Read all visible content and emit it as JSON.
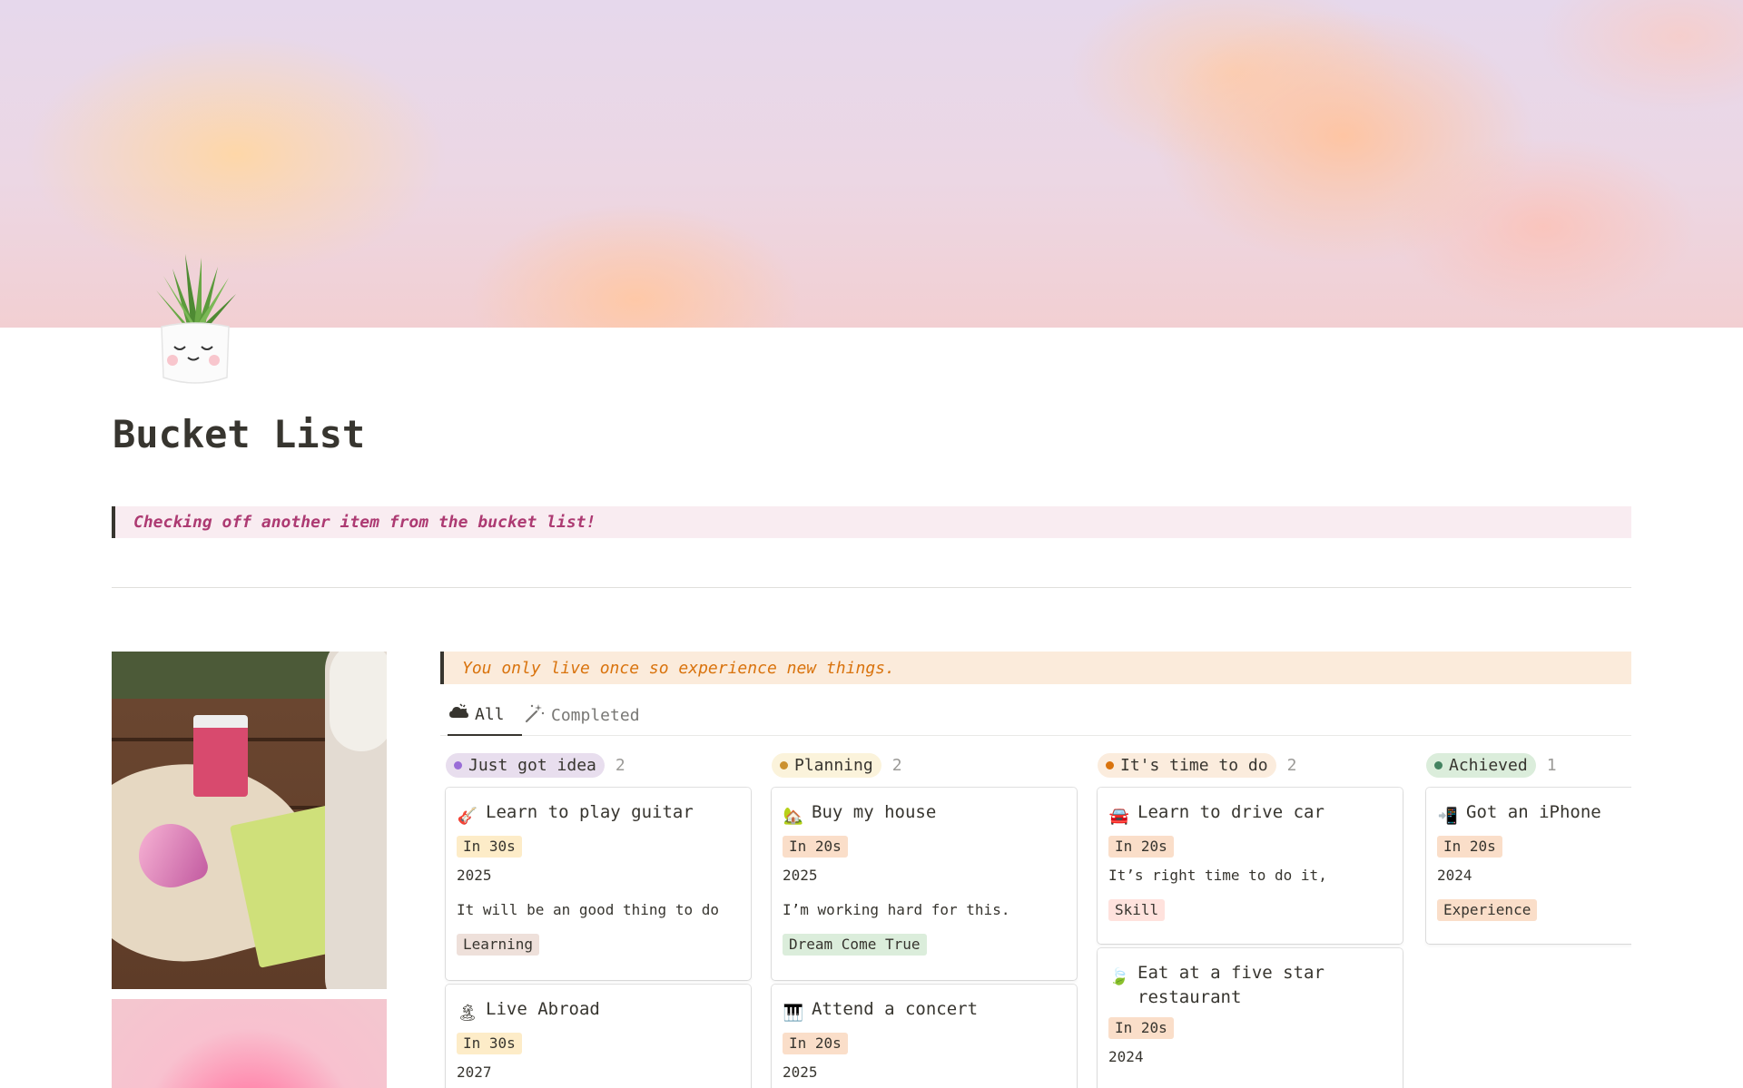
{
  "page": {
    "title": "Bucket List",
    "callout_pink": "Checking off another item from the bucket list!",
    "callout_orange": "You only live once so experience new things."
  },
  "tabs": [
    {
      "label": "All",
      "icon": "weather-icon",
      "active": true
    },
    {
      "label": "Completed",
      "icon": "magic-wand-icon",
      "active": false
    }
  ],
  "columns": [
    {
      "label": "Just got idea",
      "count": "2",
      "pill_bg": "#e8deee",
      "dot": "#9a6dd7",
      "cards": [
        {
          "emoji": "🎸",
          "icon": "guitar-icon",
          "title": "Learn to play guitar",
          "age": "In 30s",
          "age_bg": "#fdecc8",
          "year": "2025",
          "note": "It will be an good thing to do",
          "category": "Learning",
          "category_bg": "#eee0da"
        },
        {
          "emoji": "🏝",
          "icon": "island-icon",
          "title": "Live Abroad",
          "age": "In 30s",
          "age_bg": "#fdecc8",
          "year": "2027"
        }
      ]
    },
    {
      "label": "Planning",
      "count": "2",
      "pill_bg": "#fbf3db",
      "dot": "#cb912f",
      "cards": [
        {
          "emoji": "🏡",
          "icon": "house-icon",
          "title": "Buy my house",
          "age": "In 20s",
          "age_bg": "#fadec9",
          "year": "2025",
          "note": "I’m working hard for this.",
          "category": "Dream Come True",
          "category_bg": "#dbeddb"
        },
        {
          "emoji": "🎹",
          "icon": "piano-icon",
          "title": "Attend a concert",
          "age": "In 20s",
          "age_bg": "#fadec9",
          "year": "2025"
        }
      ]
    },
    {
      "label": "It's time to do",
      "count": "2",
      "pill_bg": "#fbecdd",
      "dot": "#d9730d",
      "cards": [
        {
          "emoji": "🚘",
          "icon": "car-icon",
          "title": "Learn to drive car",
          "age": "In 20s",
          "age_bg": "#fadec9",
          "note": "It’s right time to do it,",
          "category": "Skill",
          "category_bg": "#ffe2dd"
        },
        {
          "emoji": "🍃",
          "icon": "leaf-icon",
          "title": "Eat at a five star restaurant",
          "age": "In 20s",
          "age_bg": "#fadec9",
          "year": "2024"
        }
      ]
    },
    {
      "label": "Achieved",
      "count": "1",
      "pill_bg": "#dbeddb",
      "dot": "#448361",
      "cards": [
        {
          "emoji": "📲",
          "icon": "phone-icon",
          "title": "Got an iPhone",
          "age": "In 20s",
          "age_bg": "#fadec9",
          "year": "2024",
          "category": "Experience",
          "category_bg": "#fadec9"
        }
      ]
    }
  ]
}
